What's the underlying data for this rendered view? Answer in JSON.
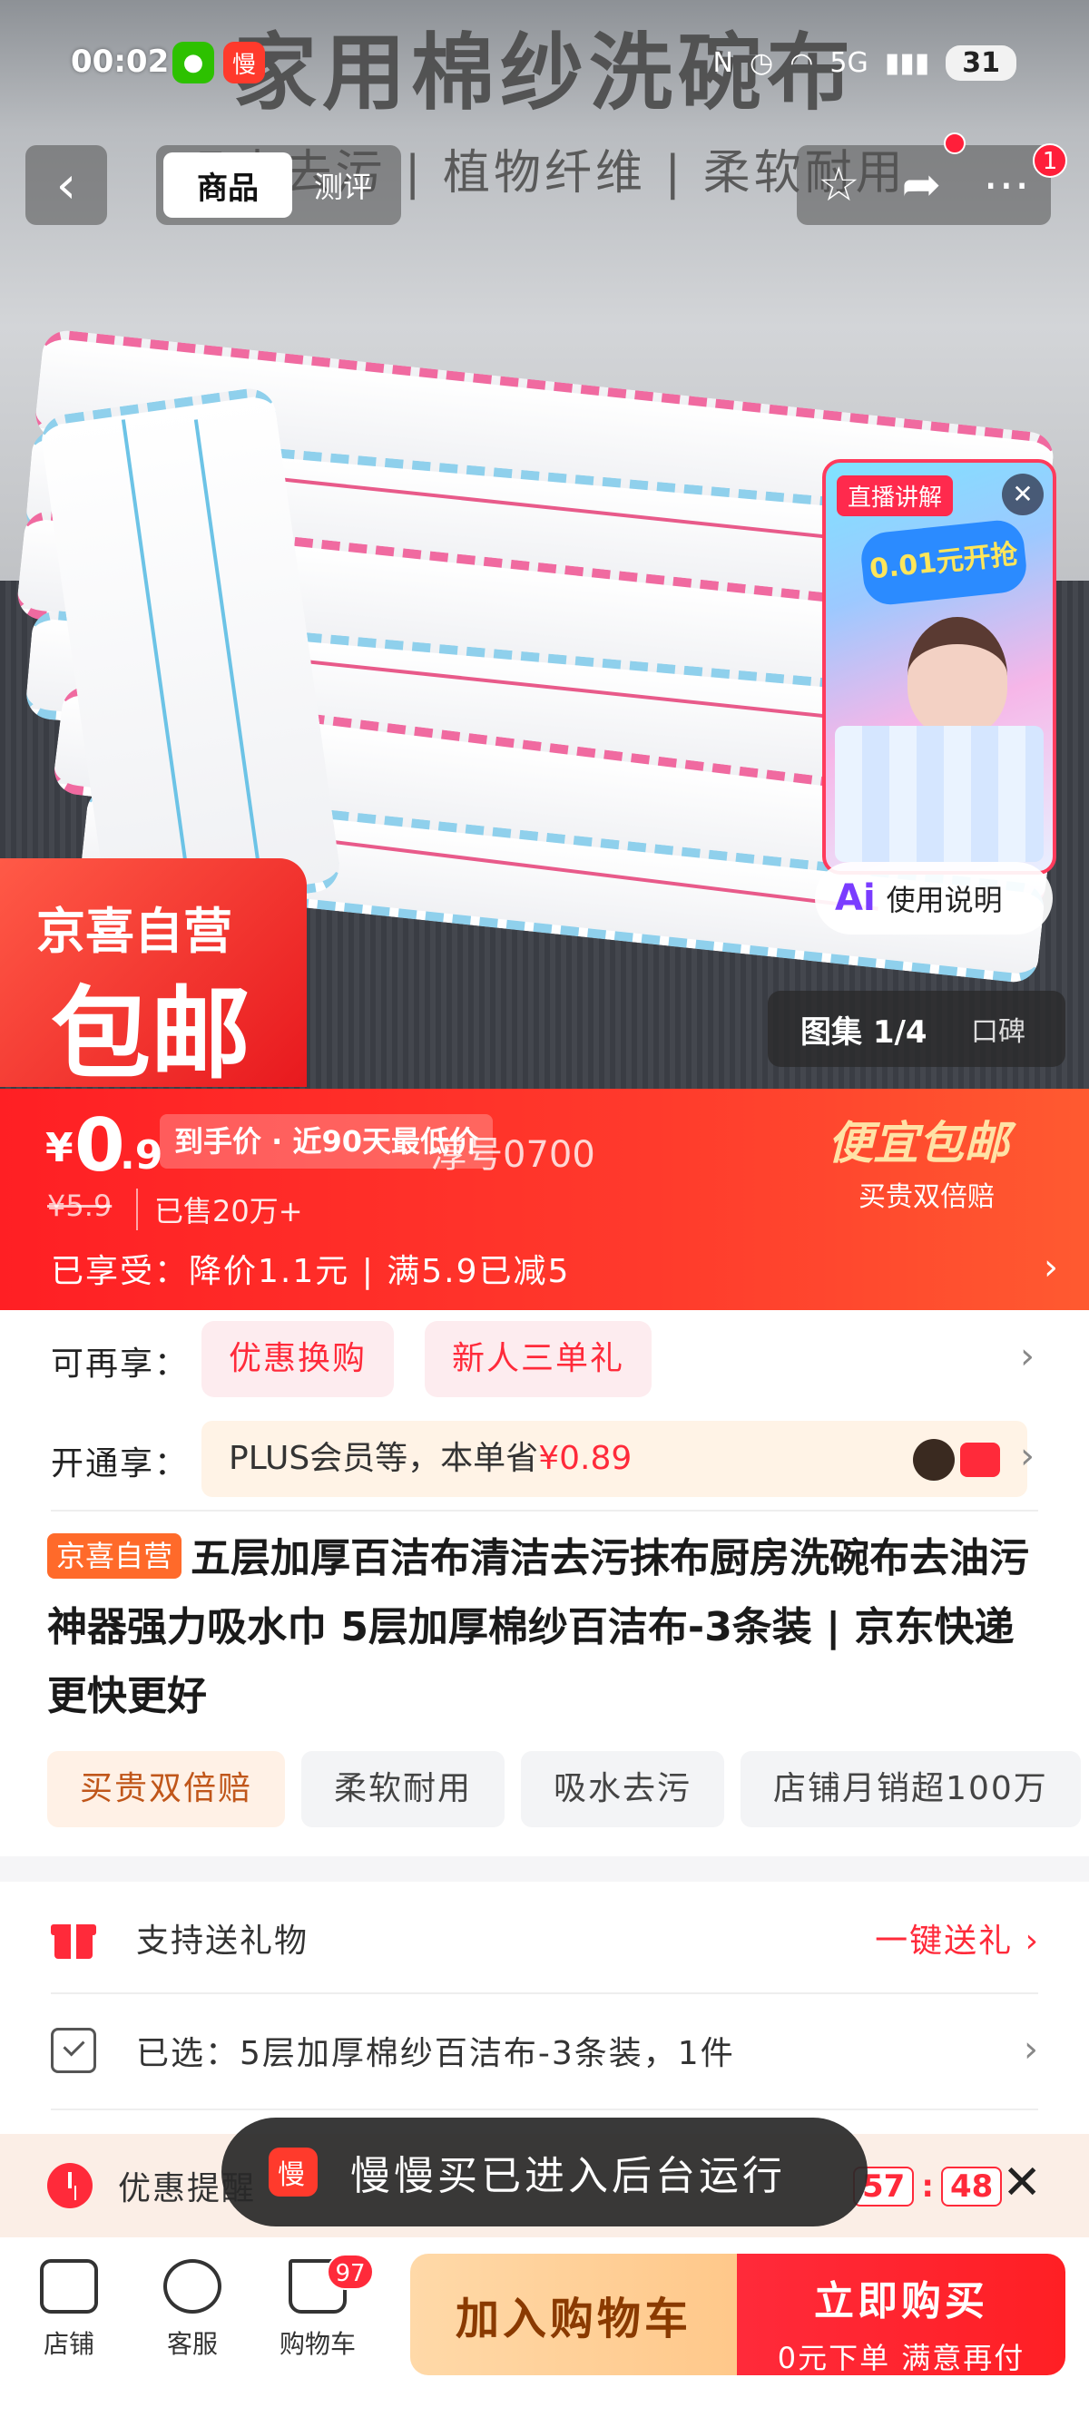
{
  "status_bar": {
    "time": "00:02",
    "battery": "31",
    "network": "5G",
    "app_badge": "慢"
  },
  "hero": {
    "title": "家用棉纱洗碗布",
    "subtitle": "吸水去污 | 植物纤维 | 柔软耐用",
    "self_operated_line1": "京喜自营",
    "self_operated_line2": "包邮",
    "gallery_label": "图集 1/4",
    "reviews_label": "口碑"
  },
  "nav": {
    "tab_product": "商品",
    "tab_review": "测评",
    "more_badge": "1"
  },
  "live_card": {
    "tag": "直播讲解",
    "banner": "0.01元开抢",
    "ai_label": "使用说明"
  },
  "price": {
    "currency": "¥",
    "integer": "0",
    "decimal": ".9",
    "low_tag": "到手价 · 近90天最低价",
    "watermark": "淳号0700",
    "original": "¥5.9",
    "sold": "已售20万+",
    "cheap_title": "便宜包邮",
    "cheap_sub": "买贵双倍赔",
    "enjoyed": "已享受：降价1.1元 | 满5.9已减5"
  },
  "promo": {
    "more_label": "可再享：",
    "chip1": "优惠换购",
    "chip2": "新人三单礼",
    "open_label": "开通享：",
    "plus_text": "PLUS会员等，本单省",
    "plus_amount": "¥0.89"
  },
  "product": {
    "badge": "京喜自营",
    "title": "五层加厚百洁布清洁去污抹布厨房洗碗布去油污神器强力吸水巾 5层加厚棉纱百洁布-3条装 | 京东快递 更快更好",
    "tags": [
      "买贵双倍赔",
      "柔软耐用",
      "吸水去污",
      "店铺月销超100万"
    ]
  },
  "rows": {
    "gift_label": "支持送礼物",
    "gift_action": "一键送礼",
    "selected_label": "已选：5层加厚棉纱百洁布-3条装，1件"
  },
  "promo_strip": {
    "label": "优惠提醒",
    "timer_min": "57",
    "timer_sec": "48"
  },
  "toast": {
    "text": "慢慢买已进入后台运行"
  },
  "bottom": {
    "shop": "店铺",
    "service": "客服",
    "cart": "购物车",
    "cart_count": "97",
    "add_cart": "加入购物车",
    "buy_now": "立即购买",
    "buy_sub": "0元下单 满意再付"
  }
}
